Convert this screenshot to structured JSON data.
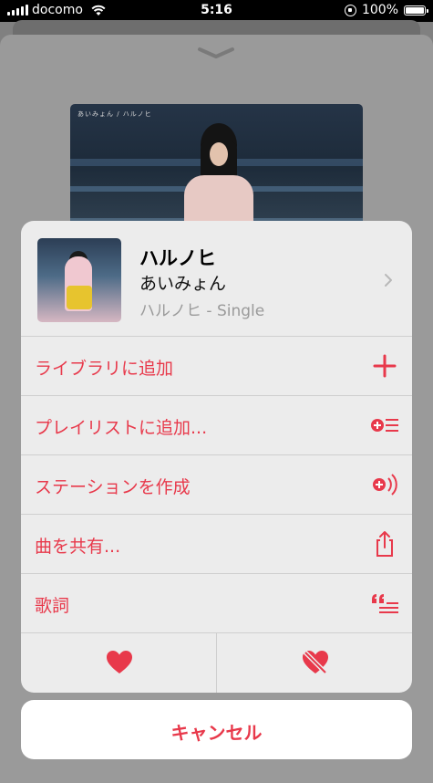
{
  "status_bar": {
    "carrier": "docomo",
    "time": "5:16",
    "battery": "100%"
  },
  "background": {
    "artwork_caption": "あいみょん / ハルノヒ"
  },
  "song": {
    "title": "ハルノヒ",
    "artist": "あいみょん",
    "album": "ハルノヒ - Single"
  },
  "menu": {
    "items": [
      {
        "label": "ライブラリに追加",
        "icon": "plus-icon"
      },
      {
        "label": "プレイリストに追加...",
        "icon": "add-to-playlist-icon"
      },
      {
        "label": "ステーションを作成",
        "icon": "create-station-icon"
      },
      {
        "label": "曲を共有...",
        "icon": "share-icon"
      },
      {
        "label": "歌詞",
        "icon": "lyrics-icon"
      }
    ]
  },
  "actions": {
    "love_icon": "heart-icon",
    "dislike_icon": "dislike-heart-icon",
    "cancel_label": "キャンセル"
  },
  "colors": {
    "accent": "#e8394b",
    "sheet_bg": "#ececec",
    "dim_bg": "#808080"
  }
}
